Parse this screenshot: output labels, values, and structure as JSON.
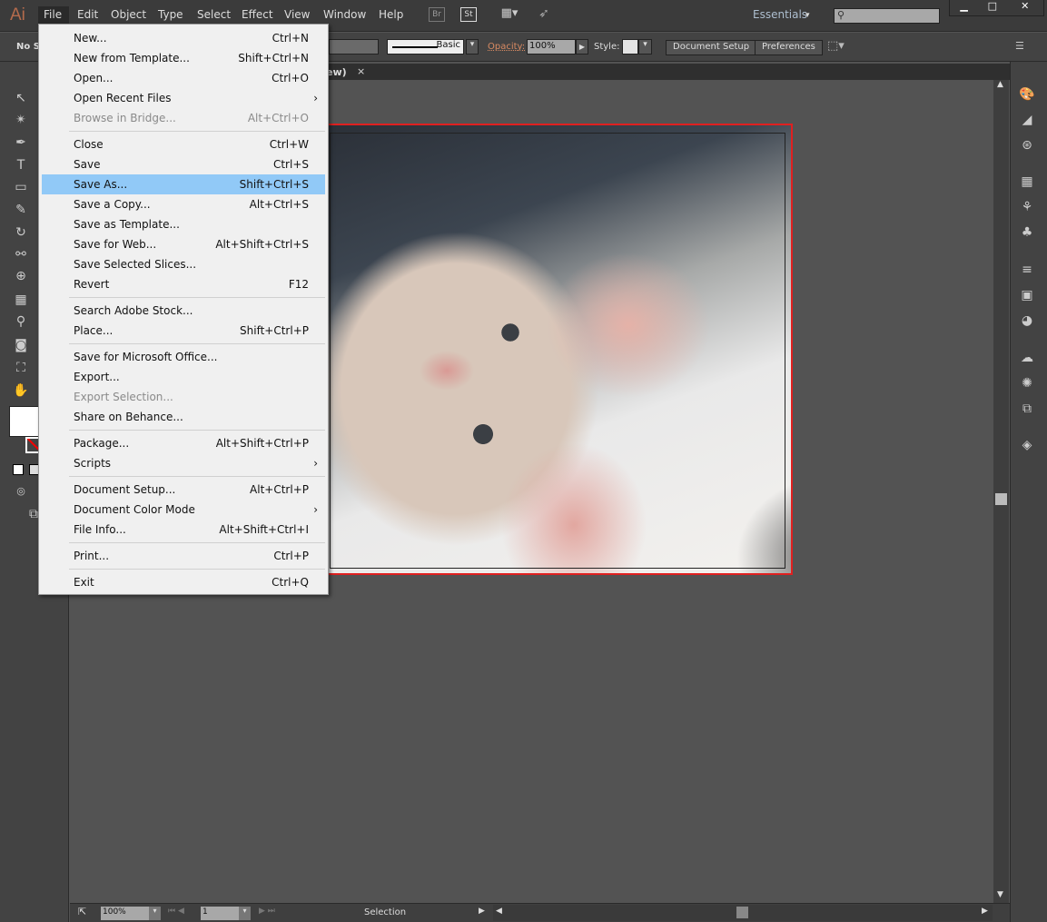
{
  "app": {
    "logo": "Ai",
    "menus": [
      "File",
      "Edit",
      "Object",
      "Type",
      "Select",
      "Effect",
      "View",
      "Window",
      "Help"
    ],
    "bridge": "Br",
    "stock": "St",
    "workspace": "Essentials",
    "search_placeholder": ""
  },
  "control": {
    "selection": "No Se",
    "stroke_style": "Basic",
    "opacity_label": "Opacity:",
    "opacity": "100%",
    "style_label": "Style:",
    "document_setup": "Document Setup",
    "preferences": "Preferences"
  },
  "tab": {
    "title": "ew)",
    "close": "×"
  },
  "status": {
    "zoom": "100%",
    "page": "1",
    "tool": "Selection"
  },
  "file_menu": {
    "groups": [
      [
        {
          "label": "New...",
          "shortcut": "Ctrl+N"
        },
        {
          "label": "New from Template...",
          "shortcut": "Shift+Ctrl+N"
        },
        {
          "label": "Open...",
          "shortcut": "Ctrl+O"
        },
        {
          "label": "Open Recent Files",
          "shortcut": "",
          "submenu": true
        },
        {
          "label": "Browse in Bridge...",
          "shortcut": "Alt+Ctrl+O",
          "disabled": true
        }
      ],
      [
        {
          "label": "Close",
          "shortcut": "Ctrl+W"
        },
        {
          "label": "Save",
          "shortcut": "Ctrl+S"
        },
        {
          "label": "Save As...",
          "shortcut": "Shift+Ctrl+S",
          "selected": true
        },
        {
          "label": "Save a Copy...",
          "shortcut": "Alt+Ctrl+S"
        },
        {
          "label": "Save as Template...",
          "shortcut": ""
        },
        {
          "label": "Save for Web...",
          "shortcut": "Alt+Shift+Ctrl+S"
        },
        {
          "label": "Save Selected Slices...",
          "shortcut": ""
        },
        {
          "label": "Revert",
          "shortcut": "F12"
        }
      ],
      [
        {
          "label": "Search Adobe Stock...",
          "shortcut": ""
        },
        {
          "label": "Place...",
          "shortcut": "Shift+Ctrl+P"
        }
      ],
      [
        {
          "label": "Save for Microsoft Office...",
          "shortcut": ""
        },
        {
          "label": "Export...",
          "shortcut": ""
        },
        {
          "label": "Export Selection...",
          "shortcut": "",
          "disabled": true
        },
        {
          "label": "Share on Behance...",
          "shortcut": ""
        }
      ],
      [
        {
          "label": "Package...",
          "shortcut": "Alt+Shift+Ctrl+P"
        },
        {
          "label": "Scripts",
          "shortcut": "",
          "submenu": true
        }
      ],
      [
        {
          "label": "Document Setup...",
          "shortcut": "Alt+Ctrl+P"
        },
        {
          "label": "Document Color Mode",
          "shortcut": "",
          "submenu": true
        },
        {
          "label": "File Info...",
          "shortcut": "Alt+Shift+Ctrl+I"
        }
      ],
      [
        {
          "label": "Print...",
          "shortcut": "Ctrl+P"
        }
      ],
      [
        {
          "label": "Exit",
          "shortcut": "Ctrl+Q"
        }
      ]
    ]
  },
  "colors": {
    "accent": "#91c9f7",
    "artboard_border": "#e02020",
    "logo": "#b56b4c"
  }
}
